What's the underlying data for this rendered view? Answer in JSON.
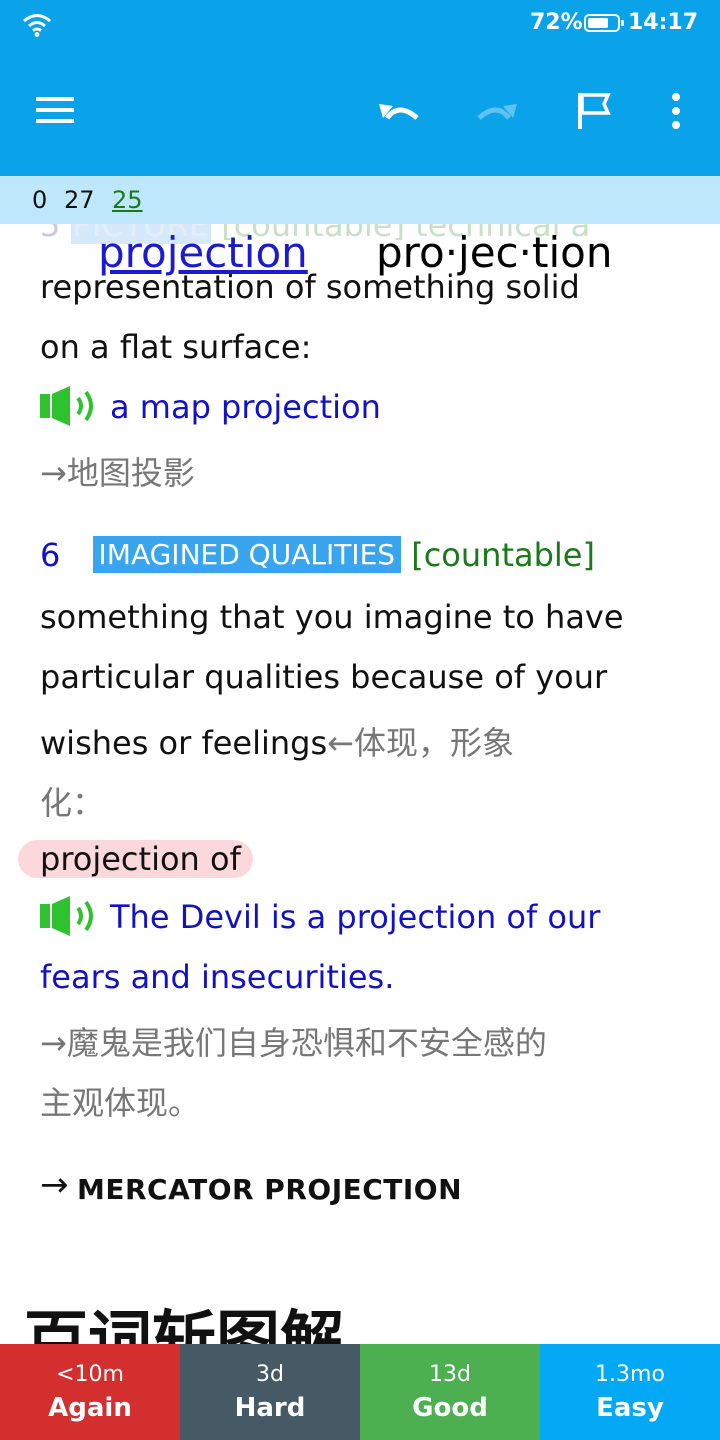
{
  "status_bar": {
    "battery": "72%",
    "battery_level": 0.72,
    "time": "14:17"
  },
  "toolbar": {
    "menu_icon": "hamburger-menu-icon",
    "undo_icon": "undo-icon",
    "redo_icon": "redo-icon",
    "flag_icon": "flag-icon",
    "more_icon": "more-vert-icon"
  },
  "counts": {
    "new": "0",
    "learning": "27",
    "review": "25"
  },
  "card": {
    "faded_sense_number": "5",
    "faded_label": "PICTURE",
    "faded_text": " [countable] technical a",
    "headword": "projection",
    "pronunciation": "pro·jec·tion",
    "def5_line1": "representation of something solid",
    "def5_line2": "on a flat surface:",
    "ex5": "a map projection",
    "ex5_cn": "→地图投影",
    "sense6_number": "6",
    "sense6_label": "IMAGINED QUALITIES",
    "sense6_grammar": "[countable]",
    "def6_line1": "something that you imagine to have",
    "def6_line2": "particular qualities because of your",
    "def6_line3": "wishes or feelings",
    "def6_cn_a": "←体现，形象",
    "def6_cn_b": "化：",
    "collocation": "projection of",
    "ex6_line1": "The Devil is a projection of our",
    "ex6_line2": "fears and insecurities.",
    "ex6_cn_line1": "→魔鬼是我们自身恐惧和不安全感的",
    "ex6_cn_line2": "主观体现。",
    "xref_arrow": "→",
    "xref": "MERCATOR PROJECTION",
    "section_title": "百词斩图解"
  },
  "answer_buttons": [
    {
      "interval": "<10m",
      "label": "Again",
      "color": "#d32f2f"
    },
    {
      "interval": "3d",
      "label": "Hard",
      "color": "#455a64"
    },
    {
      "interval": "13d",
      "label": "Good",
      "color": "#4caf50"
    },
    {
      "interval": "1.3mo",
      "label": "Easy",
      "color": "#03a9f4"
    }
  ]
}
